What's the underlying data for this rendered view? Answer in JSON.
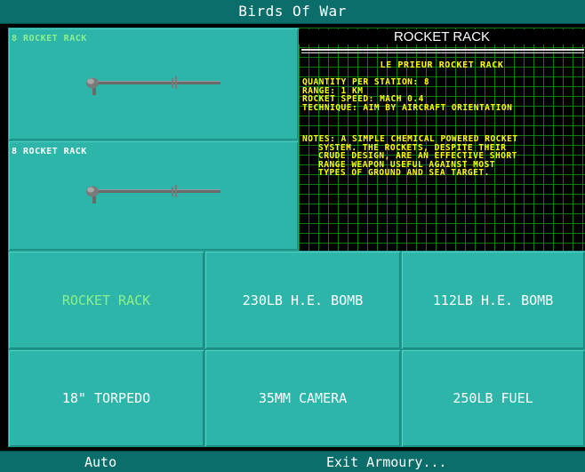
{
  "title": "Birds Of War",
  "slots": [
    {
      "label": "8 ROCKET RACK",
      "label_color": "#8cf08c"
    },
    {
      "label": "8 ROCKET RACK",
      "label_color": "#ffffff"
    }
  ],
  "info": {
    "title": "ROCKET RACK",
    "subtitle": "LE PRIEUR ROCKET RACK",
    "stats": [
      "QUANTITY PER STATION: 8",
      "RANGE: 1 KM",
      "ROCKET SPEED: MACH 0.4",
      "TECHNIQUE: AIM BY AIRCRAFT ORIENTATION"
    ],
    "notes": [
      "NOTES: A SIMPLE CHEMICAL POWERED ROCKET",
      "SYSTEM. THE ROCKETS, DESPITE THEIR",
      "CRUDE DESIGN, ARE AN EFFECTIVE SHORT",
      "RANGE WEAPON USEFUL AGAINST MOST",
      "TYPES OF GROUND AND SEA TARGET."
    ]
  },
  "weapons": [
    {
      "label": "ROCKET RACK",
      "selected": true
    },
    {
      "label": "230LB H.E. BOMB",
      "selected": false
    },
    {
      "label": "112LB H.E. BOMB",
      "selected": false
    },
    {
      "label": "18\" TORPEDO",
      "selected": false
    },
    {
      "label": "35MM CAMERA",
      "selected": false
    },
    {
      "label": "250LB FUEL",
      "selected": false
    }
  ],
  "bottom": {
    "auto_label": "Auto",
    "exit_label": "Exit Armoury..."
  },
  "colors": {
    "bar": "#0b6e6a",
    "panel": "#2db5aa",
    "selected_text": "#8cf08c",
    "info_text": "#ffff00",
    "grid": "#0f7a0f"
  }
}
